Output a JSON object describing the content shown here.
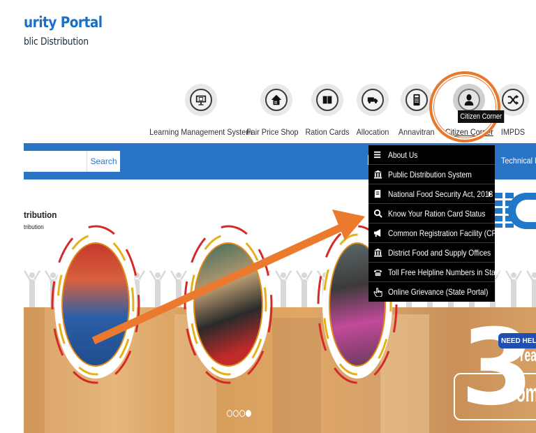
{
  "header": {
    "title": "urity Portal",
    "subtitle": "blic Distribution"
  },
  "quick_links": [
    {
      "label": "Learning Management System",
      "icon": "monitor-book-icon"
    },
    {
      "label": "Fair Price Shop",
      "icon": "house-icon"
    },
    {
      "label": "Ration Cards",
      "icon": "book-icon"
    },
    {
      "label": "Allocation",
      "icon": "truck-icon"
    },
    {
      "label": "Annavitran",
      "icon": "pos-device-icon"
    },
    {
      "label": "Citizen Corner",
      "icon": "person-icon",
      "active": true
    },
    {
      "label": "IMPDS",
      "icon": "shuffle-icon"
    }
  ],
  "tooltip": "Citizen Corner",
  "navbar": {
    "search_button": "Search",
    "search_value": "",
    "technical_link": "Technical De"
  },
  "section": {
    "title": "tribution",
    "subtitle": "tribution"
  },
  "dropdown": {
    "items": [
      {
        "label": "About Us",
        "icon": "menu-lines-icon"
      },
      {
        "label": "Public Distribution System",
        "icon": "bank-icon"
      },
      {
        "label": "National Food Security Act, 2013",
        "icon": "document-icon",
        "has_submenu": true
      },
      {
        "label": "Know Your Ration Card Status",
        "icon": "search-icon"
      },
      {
        "label": "Common Registration Facility (CRF)",
        "icon": "megaphone-icon"
      },
      {
        "label": "District Food and Supply Offices",
        "icon": "bank-icon"
      },
      {
        "label": "Toll Free Helpline Numbers in States",
        "icon": "phone-icon"
      },
      {
        "label": "Online Grievance (State Portal)",
        "icon": "pointer-hand-icon"
      }
    ]
  },
  "banner": {
    "big_number": "3",
    "years_text": "Year",
    "comp_text": "Comp",
    "need_help": "NEED HELP?",
    "carousel_total": 4,
    "carousel_active": 4
  },
  "colors": {
    "brand_blue": "#2a74c6",
    "highlight_orange": "#e8782c",
    "menu_bg": "#000000"
  }
}
